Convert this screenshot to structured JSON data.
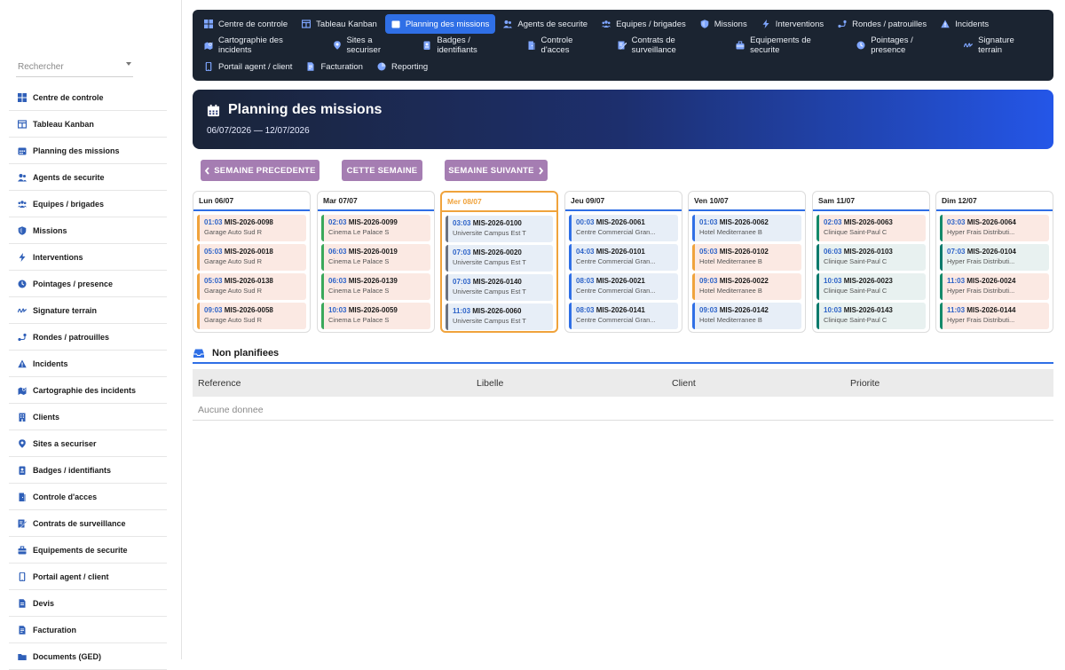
{
  "search": {
    "placeholder": "Rechercher"
  },
  "sidebar": {
    "items": [
      {
        "label": "Centre de controle",
        "icon": "grid-icon"
      },
      {
        "label": "Tableau Kanban",
        "icon": "board-icon"
      },
      {
        "label": "Planning des missions",
        "icon": "calendar-icon"
      },
      {
        "label": "Agents de securite",
        "icon": "users-icon"
      },
      {
        "label": "Equipes / brigades",
        "icon": "team-icon"
      },
      {
        "label": "Missions",
        "icon": "shield-icon"
      },
      {
        "label": "Interventions",
        "icon": "bolt-icon"
      },
      {
        "label": "Pointages / presence",
        "icon": "clock-icon"
      },
      {
        "label": "Signature terrain",
        "icon": "signature-icon"
      },
      {
        "label": "Rondes / patrouilles",
        "icon": "route-icon"
      },
      {
        "label": "Incidents",
        "icon": "warning-icon"
      },
      {
        "label": "Cartographie des incidents",
        "icon": "map-icon"
      },
      {
        "label": "Clients",
        "icon": "building-icon"
      },
      {
        "label": "Sites a securiser",
        "icon": "pin-icon"
      },
      {
        "label": "Badges / identifiants",
        "icon": "badge-icon"
      },
      {
        "label": "Controle d'acces",
        "icon": "door-icon"
      },
      {
        "label": "Contrats de surveillance",
        "icon": "contract-icon"
      },
      {
        "label": "Equipements de securite",
        "icon": "toolbox-icon"
      },
      {
        "label": "Portail agent / client",
        "icon": "mobile-icon"
      },
      {
        "label": "Devis",
        "icon": "document-icon"
      },
      {
        "label": "Facturation",
        "icon": "invoice-icon"
      },
      {
        "label": "Documents (GED)",
        "icon": "folder-icon"
      }
    ]
  },
  "topnav": {
    "rows": [
      [
        {
          "label": "Centre de controle",
          "icon": "grid-icon",
          "active": false
        },
        {
          "label": "Tableau Kanban",
          "icon": "board-icon",
          "active": false
        },
        {
          "label": "Planning des missions",
          "icon": "calendar-icon",
          "active": true
        },
        {
          "label": "Agents de securite",
          "icon": "users-icon",
          "active": false
        },
        {
          "label": "Equipes / brigades",
          "icon": "team-icon",
          "active": false
        },
        {
          "label": "Missions",
          "icon": "shield-icon",
          "active": false
        },
        {
          "label": "Interventions",
          "icon": "bolt-icon",
          "active": false
        },
        {
          "label": "Rondes / patrouilles",
          "icon": "route-icon",
          "active": false
        },
        {
          "label": "Incidents",
          "icon": "warning-icon",
          "active": false
        }
      ],
      [
        {
          "label": "Cartographie des incidents",
          "icon": "map-icon",
          "active": false
        },
        {
          "label": "Sites a securiser",
          "icon": "pin-icon",
          "active": false
        },
        {
          "label": "Badges / identifiants",
          "icon": "badge-icon",
          "active": false
        },
        {
          "label": "Controle d'acces",
          "icon": "door-icon",
          "active": false
        },
        {
          "label": "Contrats de surveillance",
          "icon": "contract-icon",
          "active": false
        },
        {
          "label": "Equipements de securite",
          "icon": "toolbox-icon",
          "active": false
        },
        {
          "label": "Pointages / presence",
          "icon": "clock-icon",
          "active": false
        },
        {
          "label": "Signature terrain",
          "icon": "signature-icon",
          "active": false
        }
      ],
      [
        {
          "label": "Portail agent / client",
          "icon": "mobile-icon",
          "active": false
        },
        {
          "label": "Facturation",
          "icon": "invoice-icon",
          "active": false
        },
        {
          "label": "Reporting",
          "icon": "chart-icon",
          "active": false
        }
      ]
    ]
  },
  "banner": {
    "title": "Planning des missions",
    "dates": "06/07/2026 — 12/07/2026"
  },
  "buttons": {
    "prev": "SEMAINE PRECEDENTE",
    "current": "CETTE SEMAINE",
    "next": "SEMAINE SUIVANTE"
  },
  "week": [
    {
      "label": "Lun 06/07",
      "today": false,
      "missions": [
        {
          "time": "01:03",
          "code": "MIS-2026-0098",
          "site": "Garage Auto Sud R",
          "status": "orange"
        },
        {
          "time": "05:03",
          "code": "MIS-2026-0018",
          "site": "Garage Auto Sud R",
          "status": "orange"
        },
        {
          "time": "05:03",
          "code": "MIS-2026-0138",
          "site": "Garage Auto Sud R",
          "status": "orange"
        },
        {
          "time": "09:03",
          "code": "MIS-2026-0058",
          "site": "Garage Auto Sud R",
          "status": "orange"
        }
      ]
    },
    {
      "label": "Mar 07/07",
      "today": false,
      "missions": [
        {
          "time": "02:03",
          "code": "MIS-2026-0099",
          "site": "Cinema Le Palace S",
          "status": "green"
        },
        {
          "time": "06:03",
          "code": "MIS-2026-0019",
          "site": "Cinema Le Palace S",
          "status": "green"
        },
        {
          "time": "06:03",
          "code": "MIS-2026-0139",
          "site": "Cinema Le Palace S",
          "status": "green"
        },
        {
          "time": "10:03",
          "code": "MIS-2026-0059",
          "site": "Cinema Le Palace S",
          "status": "green"
        }
      ]
    },
    {
      "label": "Mer 08/07",
      "today": true,
      "missions": [
        {
          "time": "03:03",
          "code": "MIS-2026-0100",
          "site": "Universite Campus Est T",
          "status": "grey"
        },
        {
          "time": "07:03",
          "code": "MIS-2026-0020",
          "site": "Universite Campus Est T",
          "status": "grey"
        },
        {
          "time": "07:03",
          "code": "MIS-2026-0140",
          "site": "Universite Campus Est T",
          "status": "grey"
        },
        {
          "time": "11:03",
          "code": "MIS-2026-0060",
          "site": "Universite Campus Est T",
          "status": "grey"
        }
      ]
    },
    {
      "label": "Jeu 09/07",
      "today": false,
      "missions": [
        {
          "time": "00:03",
          "code": "MIS-2026-0061",
          "site": "Centre Commercial Gran...",
          "status": "blue"
        },
        {
          "time": "04:03",
          "code": "MIS-2026-0101",
          "site": "Centre Commercial Gran...",
          "status": "blue"
        },
        {
          "time": "08:03",
          "code": "MIS-2026-0021",
          "site": "Centre Commercial Gran...",
          "status": "blue"
        },
        {
          "time": "08:03",
          "code": "MIS-2026-0141",
          "site": "Centre Commercial Gran...",
          "status": "blue"
        }
      ]
    },
    {
      "label": "Ven 10/07",
      "today": false,
      "missions": [
        {
          "time": "01:03",
          "code": "MIS-2026-0062",
          "site": "Hotel Mediterranee B",
          "status": "blue"
        },
        {
          "time": "05:03",
          "code": "MIS-2026-0102",
          "site": "Hotel Mediterranee B",
          "status": "orange"
        },
        {
          "time": "09:03",
          "code": "MIS-2026-0022",
          "site": "Hotel Mediterranee B",
          "status": "orange"
        },
        {
          "time": "09:03",
          "code": "MIS-2026-0142",
          "site": "Hotel Mediterranee B",
          "status": "blue"
        }
      ]
    },
    {
      "label": "Sam 11/07",
      "today": false,
      "missions": [
        {
          "time": "02:03",
          "code": "MIS-2026-0063",
          "site": "Clinique Saint-Paul C",
          "status": "gteal"
        },
        {
          "time": "06:03",
          "code": "MIS-2026-0103",
          "site": "Clinique Saint-Paul C",
          "status": "teal"
        },
        {
          "time": "10:03",
          "code": "MIS-2026-0023",
          "site": "Clinique Saint-Paul C",
          "status": "teal"
        },
        {
          "time": "10:03",
          "code": "MIS-2026-0143",
          "site": "Clinique Saint-Paul C",
          "status": "teal"
        }
      ]
    },
    {
      "label": "Dim 12/07",
      "today": false,
      "missions": [
        {
          "time": "03:03",
          "code": "MIS-2026-0064",
          "site": "Hyper Frais Distributi...",
          "status": "gteal"
        },
        {
          "time": "07:03",
          "code": "MIS-2026-0104",
          "site": "Hyper Frais Distributi...",
          "status": "teal"
        },
        {
          "time": "11:03",
          "code": "MIS-2026-0024",
          "site": "Hyper Frais Distributi...",
          "status": "gteal"
        },
        {
          "time": "11:03",
          "code": "MIS-2026-0144",
          "site": "Hyper Frais Distributi...",
          "status": "gteal"
        }
      ]
    }
  ],
  "unplanned": {
    "title": "Non planifiees",
    "columns": [
      "Reference",
      "Libelle",
      "Client",
      "Priorite"
    ],
    "empty": "Aucune donnee"
  },
  "colors": {
    "accent": "#2f6fe6",
    "nav_bg": "#1b2431",
    "button": "#a57db2",
    "today": "#f0a33c"
  }
}
